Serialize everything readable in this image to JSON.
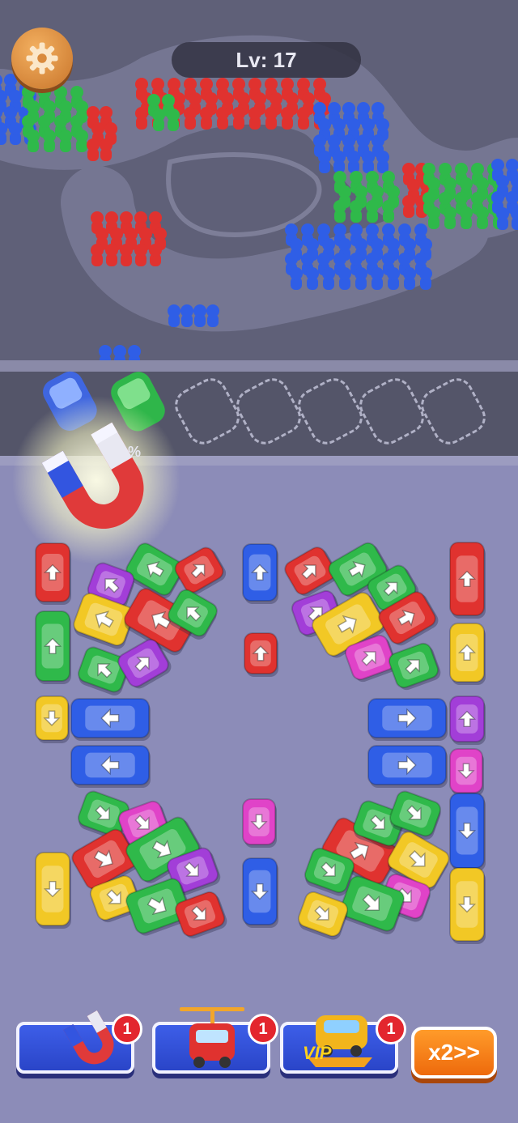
{
  "hud": {
    "level_label": "Lv: 17",
    "progress_text": "%",
    "settings_icon": "gear-icon"
  },
  "dock": {
    "empty_slots": 5,
    "docked_cars": [
      {
        "color": "#3f66e0",
        "type": "car"
      },
      {
        "color": "#2fb64a",
        "type": "car"
      }
    ]
  },
  "boosters": [
    {
      "name": "magnet",
      "icon": "magnet-icon",
      "count": "1"
    },
    {
      "name": "helicopter",
      "icon": "helicopter-car-icon",
      "count": "1"
    },
    {
      "name": "vip",
      "icon": "vip-car-icon",
      "label": "VIP",
      "count": "1"
    }
  ],
  "speed_button": {
    "label": "x2>>"
  },
  "colors": {
    "red": "#e0322f",
    "blue": "#2f5ee6",
    "green": "#2fb94a",
    "yellow": "#f2c825",
    "purple": "#a23ed8",
    "pink": "#e043c8"
  }
}
